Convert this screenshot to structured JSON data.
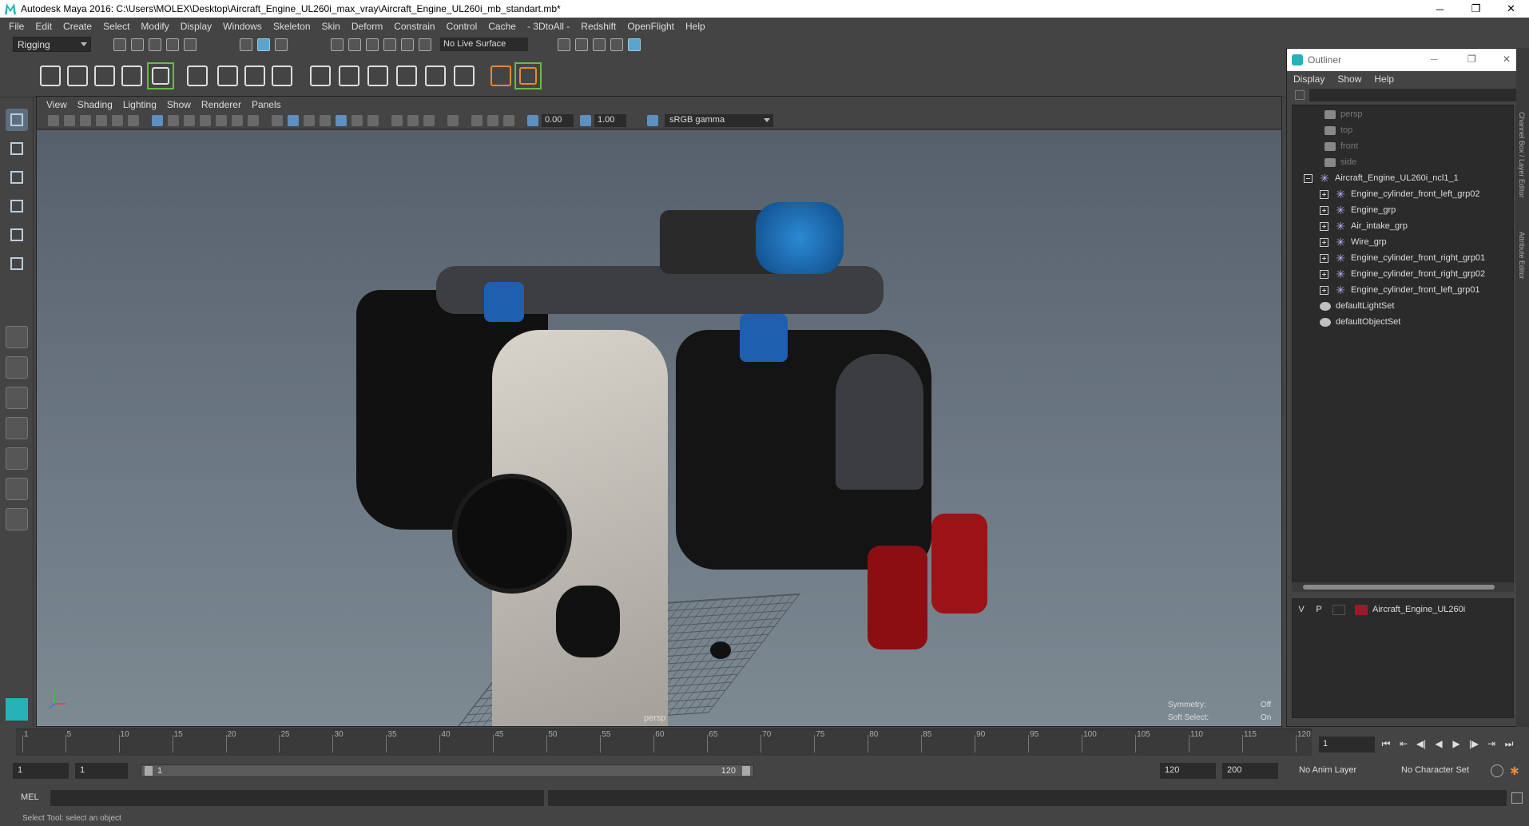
{
  "window": {
    "title": "Autodesk Maya 2016: C:\\Users\\MOLEX\\Desktop\\Aircraft_Engine_UL260i_max_vray\\Aircraft_Engine_UL260i_mb_standart.mb*",
    "controls": [
      "─",
      "❐",
      "✕"
    ]
  },
  "menubar": [
    "File",
    "Edit",
    "Create",
    "Select",
    "Modify",
    "Display",
    "Windows",
    "Skeleton",
    "Skin",
    "Deform",
    "Constrain",
    "Control",
    "Cache",
    "- 3DtoAll -",
    "Redshift",
    "OpenFlight",
    "Help"
  ],
  "shelf": {
    "mode": "Rigging",
    "live_surface": "No Live Surface"
  },
  "viewport": {
    "menu": [
      "View",
      "Shading",
      "Lighting",
      "Show",
      "Renderer",
      "Panels"
    ],
    "near_value": "0.00",
    "far_value": "1.00",
    "color_space": "sRGB gamma",
    "camera_label": "persp",
    "symmetry_label": "Symmetry:",
    "symmetry_value": "Off",
    "soft_select_label": "Soft Select:",
    "soft_select_value": "On"
  },
  "outliner": {
    "title": "Outliner",
    "menu": [
      "Display",
      "Show",
      "Help"
    ],
    "items": [
      {
        "label": "persp",
        "type": "camera",
        "dim": true
      },
      {
        "label": "top",
        "type": "camera",
        "dim": true
      },
      {
        "label": "front",
        "type": "camera",
        "dim": true
      },
      {
        "label": "side",
        "type": "camera",
        "dim": true
      },
      {
        "label": "Aircraft_Engine_UL260i_ncl1_1",
        "type": "group"
      },
      {
        "label": "Engine_cylinder_front_left_grp02",
        "type": "group"
      },
      {
        "label": "Engine_grp",
        "type": "group"
      },
      {
        "label": "Air_intake_grp",
        "type": "group"
      },
      {
        "label": "Wire_grp",
        "type": "group"
      },
      {
        "label": "Engine_cylinder_front_right_grp01",
        "type": "group"
      },
      {
        "label": "Engine_cylinder_front_right_grp02",
        "type": "group"
      },
      {
        "label": "Engine_cylinder_front_left_grp01",
        "type": "group"
      },
      {
        "label": "defaultLightSet",
        "type": "set"
      },
      {
        "label": "defaultObjectSet",
        "type": "set"
      }
    ],
    "layer": {
      "visible": "V",
      "playback": "P",
      "name": "Aircraft_Engine_UL260i",
      "color": "#9b1a2a"
    }
  },
  "side_tabs": [
    "Channel Box / Layer Editor",
    "Attribute Editor"
  ],
  "timeline": {
    "ticks": [
      "1",
      "5",
      "10",
      "15",
      "20",
      "25",
      "30",
      "35",
      "40",
      "45",
      "50",
      "55",
      "60",
      "65",
      "70",
      "75",
      "80",
      "85",
      "90",
      "95",
      "100",
      "105",
      "110",
      "115",
      "120"
    ],
    "current_frame": "1",
    "playback": [
      "⏮",
      "⇤",
      "◀|",
      "◀",
      "▶",
      "|▶",
      "⇥",
      "⏭"
    ]
  },
  "range": {
    "start": "1",
    "playback_start": "1",
    "slider_start": "1",
    "slider_end": "120",
    "playback_end": "120",
    "end": "200",
    "anim_layer": "No Anim Layer",
    "character_set": "No Character Set"
  },
  "command": {
    "label": "MEL",
    "help": "Select Tool: select an object"
  },
  "colors": {
    "accent": "#27b2b8",
    "active_tool": "#5d6e7e",
    "group_icon": "#b9b1ff"
  }
}
